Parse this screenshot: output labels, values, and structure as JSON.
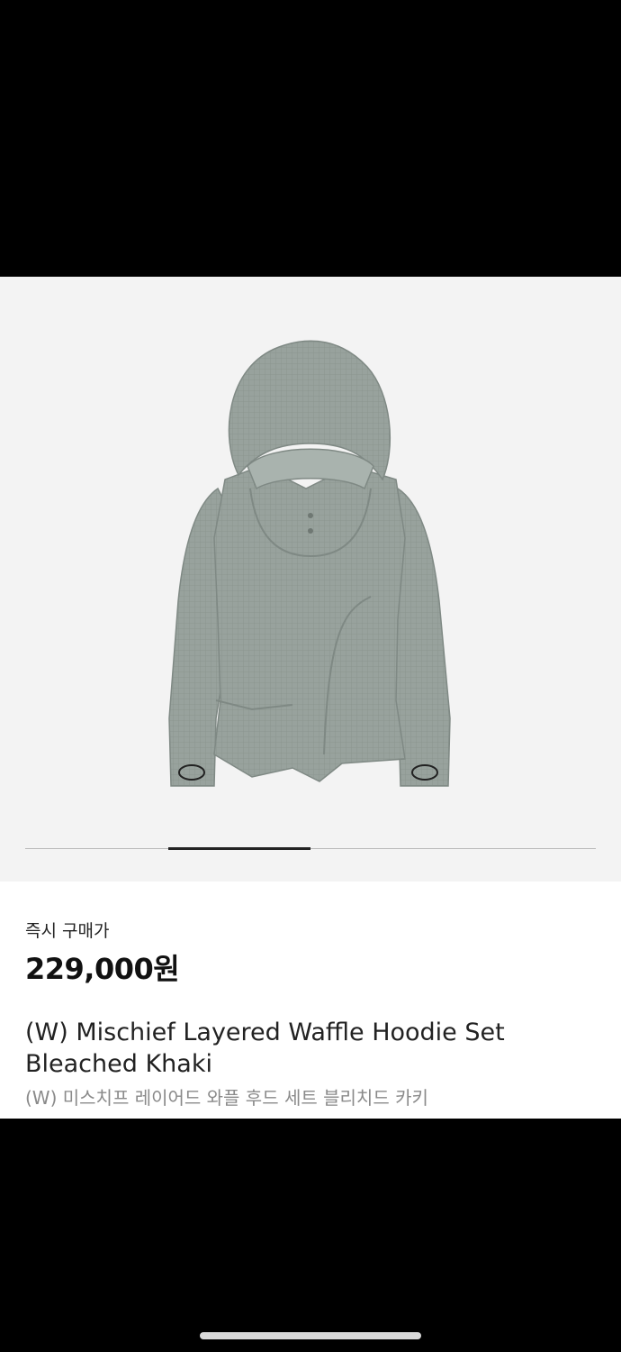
{
  "product": {
    "image_name": "mischief-layered-waffle-hoodie-image",
    "carousel": {
      "current_index": 2,
      "total": 4
    },
    "price_label": "즉시 구매가",
    "price": "229,000원",
    "title_en": "(W) Mischief Layered Waffle Hoodie Set Bleached Khaki",
    "title_ko": "(W) 미스치프 레이어드 와플 후드 세트 블리치드 카키"
  },
  "colors": {
    "garment": "#9aa39e",
    "garment_dark": "#7f8984",
    "background": "#f3f3f3"
  }
}
